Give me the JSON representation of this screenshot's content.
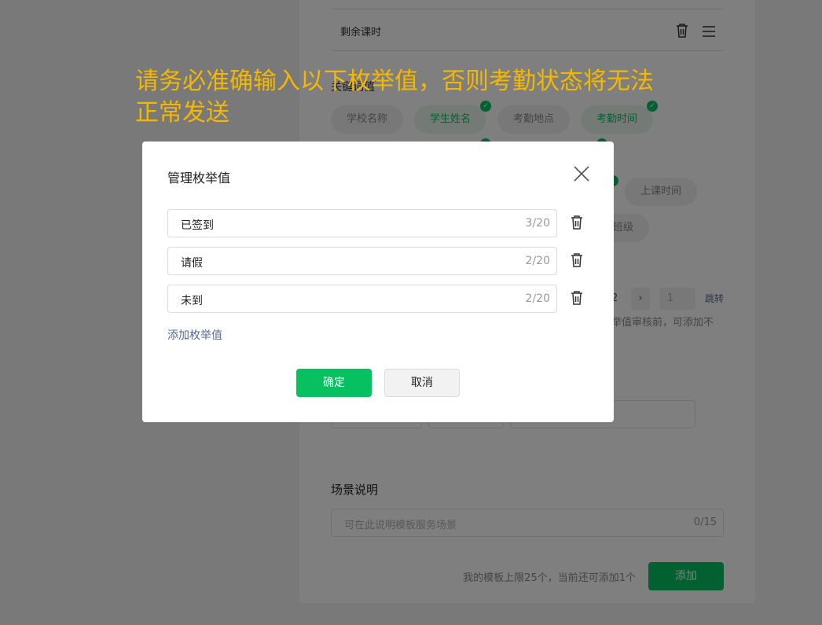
{
  "background": {
    "remaining_row_label": "剩余课时",
    "keyword_label": "关键词值",
    "chips": [
      {
        "label": "学校名称",
        "selected": false
      },
      {
        "label": "学生姓名",
        "selected": true
      },
      {
        "label": "考勤地点",
        "selected": false
      },
      {
        "label": "考勤时间",
        "selected": true
      },
      {
        "label": "上课时间",
        "selected": false
      },
      {
        "label": "班级",
        "selected": false
      }
    ],
    "pagination": {
      "last_page": "2",
      "next": "›",
      "jump_value": "1",
      "jump_label": "跳转"
    },
    "partial_note": "举值审核前，可添加不",
    "scene_title": "场景说明",
    "scene_placeholder": "可在此说明模板服务场景",
    "scene_counter": "0/15",
    "limit_text": "我的模板上限25个，当前还可添加1个",
    "add_button": "添加"
  },
  "notice": "请务必准确输入以下枚举值，否则考勤状态将无法正常发送",
  "dialog": {
    "title": "管理枚举值",
    "items": [
      {
        "value": "已签到",
        "counter": "3/20"
      },
      {
        "value": "请假",
        "counter": "2/20"
      },
      {
        "value": "未到",
        "counter": "2/20"
      }
    ],
    "add_link": "添加枚举值",
    "confirm": "确定",
    "cancel": "取消"
  },
  "colors": {
    "accent": "#07c160",
    "link": "#576b95",
    "notice": "#f5b800"
  }
}
